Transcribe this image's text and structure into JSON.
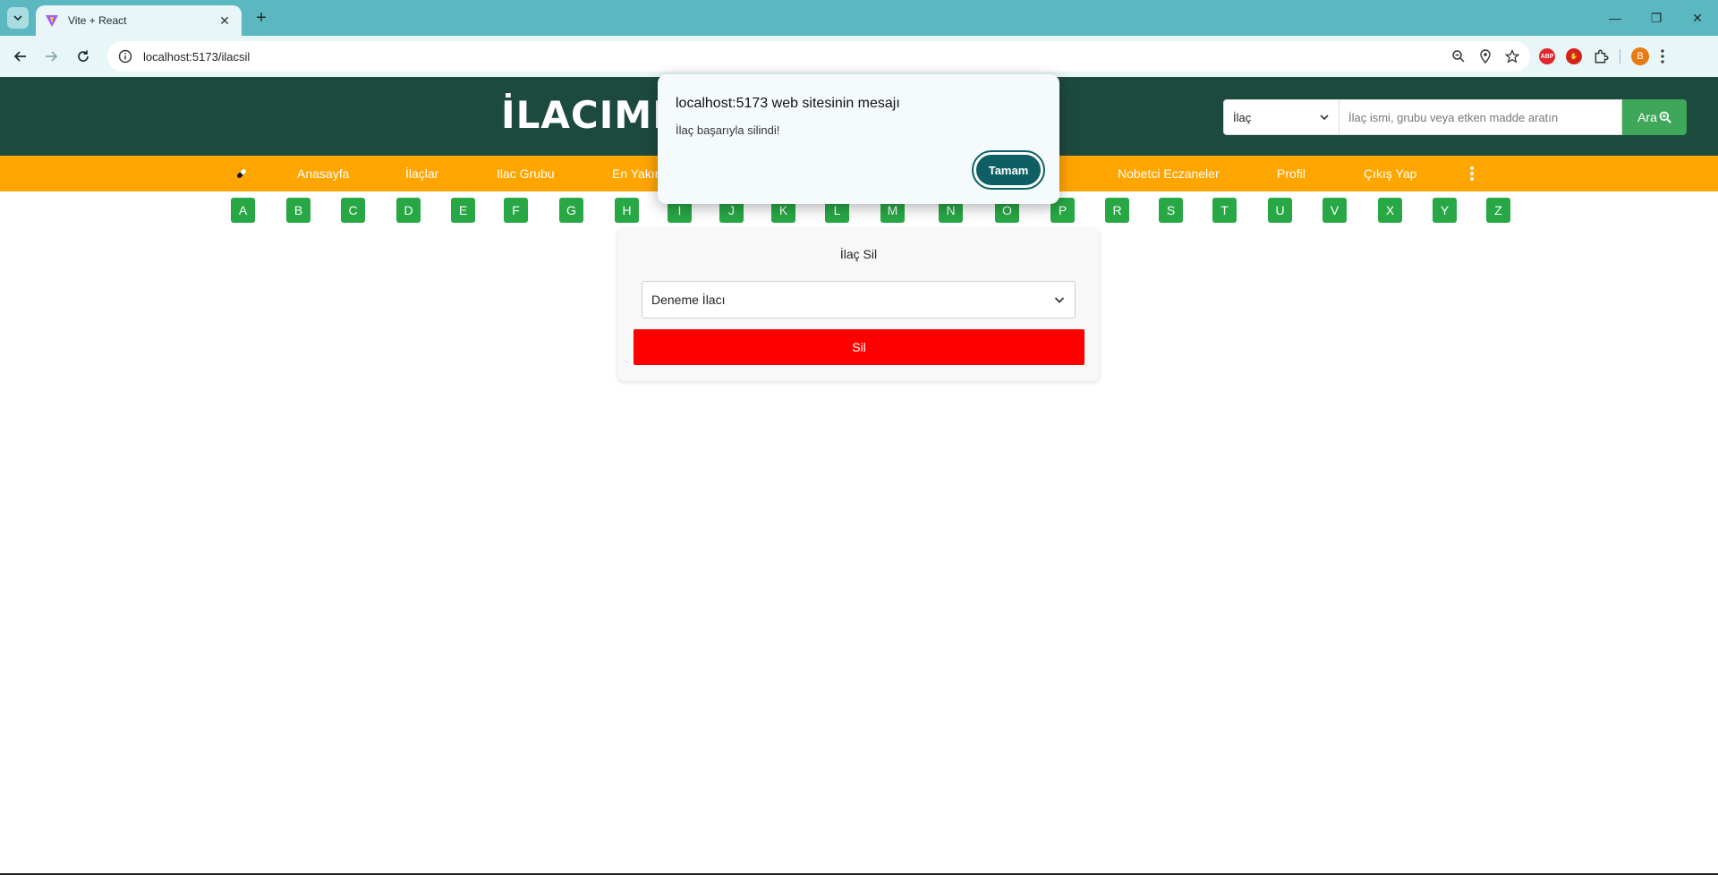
{
  "browser": {
    "tab_title": "Vite + React",
    "url": "localhost:5173/ilacsil",
    "profile_initial": "B",
    "ext_abp": "ABP"
  },
  "header": {
    "logo": "İLACIMI",
    "search_select_value": "İlaç",
    "search_placeholder": "İlaç ismi, grubu veya etken madde aratın",
    "search_button": "Ara"
  },
  "nav": {
    "items": [
      "Anasayfa",
      "İlaçlar",
      "Ilac Grubu",
      "En Yakın",
      "Nobetci Eczaneler",
      "Profil",
      "Çıkış Yap"
    ]
  },
  "letters": [
    "A",
    "B",
    "C",
    "D",
    "E",
    "F",
    "G",
    "H",
    "I",
    "J",
    "K",
    "L",
    "M",
    "N",
    "O",
    "P",
    "R",
    "S",
    "T",
    "U",
    "V",
    "X",
    "Y",
    "Z"
  ],
  "card": {
    "title": "İlaç Sil",
    "selected": "Deneme İlacı",
    "delete_button": "Sil"
  },
  "dialog": {
    "title": "localhost:5173 web sitesinin mesajı",
    "message": "İlaç başarıyla silindi!",
    "ok_button": "Tamam"
  },
  "colors": {
    "header_bg": "#1d4a3f",
    "nav_bg": "#ffa500",
    "letter_bg": "#28a745",
    "delete_bg": "#ff0000",
    "dialog_button": "#0d5f63"
  }
}
